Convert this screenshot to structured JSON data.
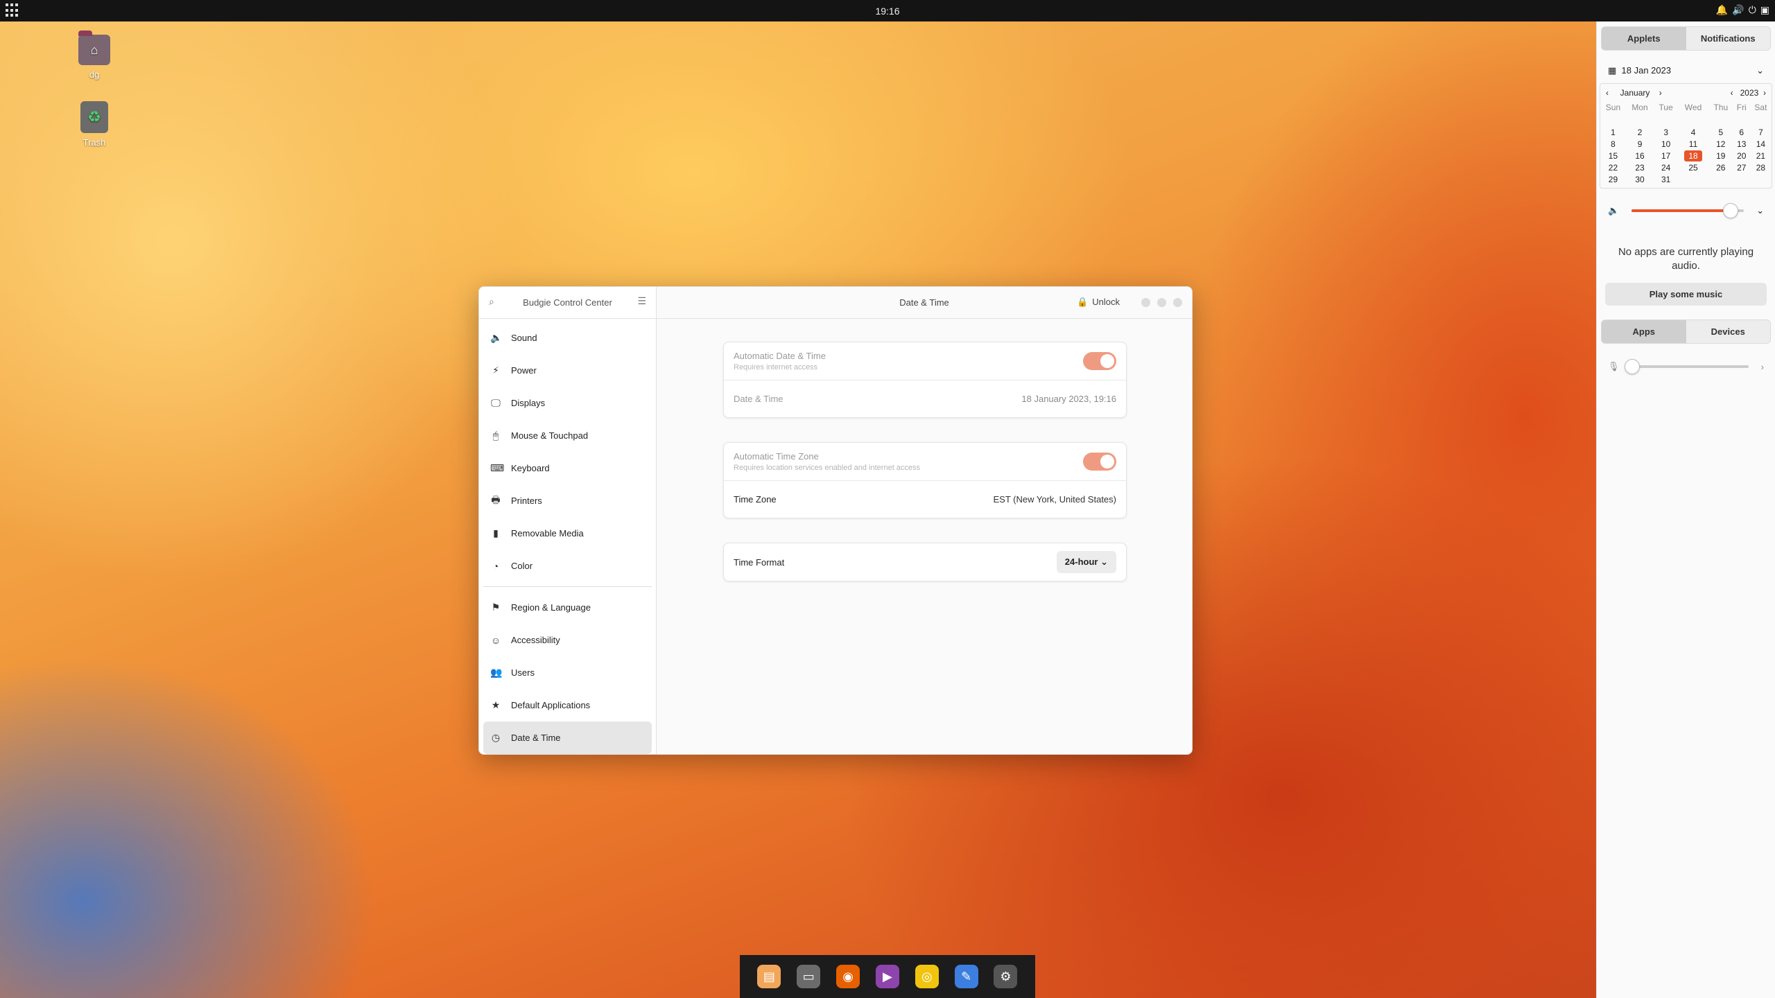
{
  "topbar": {
    "clock": "19:16"
  },
  "desktop": {
    "icons": [
      {
        "label": "dg",
        "icon": "home-folder-icon"
      },
      {
        "label": "Trash",
        "icon": "trash-icon"
      }
    ]
  },
  "window": {
    "app_title": "Budgie Control Center",
    "page_title": "Date & Time",
    "unlock_label": "Unlock",
    "sidebar": [
      {
        "label": "Sound",
        "icon": "sound-icon"
      },
      {
        "label": "Power",
        "icon": "power-icon"
      },
      {
        "label": "Displays",
        "icon": "display-icon"
      },
      {
        "label": "Mouse & Touchpad",
        "icon": "mouse-icon"
      },
      {
        "label": "Keyboard",
        "icon": "keyboard-icon"
      },
      {
        "label": "Printers",
        "icon": "printer-icon"
      },
      {
        "label": "Removable Media",
        "icon": "usb-icon"
      },
      {
        "label": "Color",
        "icon": "color-icon"
      },
      {
        "label": "Region & Language",
        "icon": "flag-icon"
      },
      {
        "label": "Accessibility",
        "icon": "accessibility-icon"
      },
      {
        "label": "Users",
        "icon": "users-icon"
      },
      {
        "label": "Default Applications",
        "icon": "star-icon"
      },
      {
        "label": "Date & Time",
        "icon": "clock-icon",
        "selected": true
      }
    ],
    "settings": {
      "auto_datetime": {
        "title": "Automatic Date & Time",
        "subtitle": "Requires internet access",
        "enabled": true
      },
      "datetime": {
        "label": "Date & Time",
        "value": "18 January 2023, 19:16"
      },
      "auto_timezone": {
        "title": "Automatic Time Zone",
        "subtitle": "Requires location services enabled and internet access",
        "enabled": true
      },
      "timezone": {
        "label": "Time Zone",
        "value": "EST (New York, United States)"
      },
      "time_format": {
        "label": "Time Format",
        "value": "24-hour"
      }
    }
  },
  "panel": {
    "tabs": [
      "Applets",
      "Notifications"
    ],
    "date_header": "18 Jan 2023",
    "calendar": {
      "month": "January",
      "year": "2023",
      "weekdays": [
        "Sun",
        "Mon",
        "Tue",
        "Wed",
        "Thu",
        "Fri",
        "Sat"
      ],
      "weeks": [
        [
          "1",
          "2",
          "3",
          "4",
          "5",
          "6",
          "7"
        ],
        [
          "8",
          "9",
          "10",
          "11",
          "12",
          "13",
          "14"
        ],
        [
          "15",
          "16",
          "17",
          "18",
          "19",
          "20",
          "21"
        ],
        [
          "22",
          "23",
          "24",
          "25",
          "26",
          "27",
          "28"
        ],
        [
          "29",
          "30",
          "31",
          "",
          "",
          "",
          ""
        ]
      ],
      "today": "18"
    },
    "volume_level": 0.88,
    "no_audio_text": "No apps are currently playing audio.",
    "play_button": "Play some music",
    "device_tabs": [
      "Apps",
      "Devices"
    ],
    "mic_level": 0.0
  },
  "dock": {
    "apps": [
      {
        "icon": "archive-icon",
        "color": "#f2a65a"
      },
      {
        "icon": "files-icon",
        "color": "#6b6b6b"
      },
      {
        "icon": "firefox-icon",
        "color": "#e66000"
      },
      {
        "icon": "video-player-icon",
        "color": "#8e44ad"
      },
      {
        "icon": "music-player-icon",
        "color": "#f1c40f"
      },
      {
        "icon": "text-editor-icon",
        "color": "#3d7fe0"
      },
      {
        "icon": "settings-icon",
        "color": "#555555"
      }
    ]
  }
}
